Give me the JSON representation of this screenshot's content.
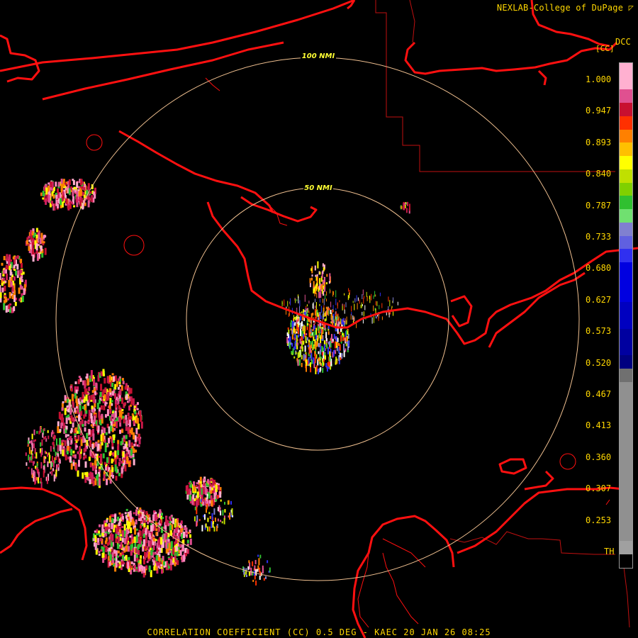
{
  "header": {
    "credit": "NEXLAB-College of DuPage",
    "product_code": "DCC",
    "product_unit": "[CC]"
  },
  "footer": {
    "title": "CORRELATION COEFFICIENT (CC) 0.5 DEG - KAEC 20 JAN 26 08:25"
  },
  "range_rings": [
    {
      "label": "100 NMI"
    },
    {
      "label": "50 NMI"
    }
  ],
  "legend": {
    "ticks": [
      "1.000",
      "0.947",
      "0.893",
      "0.840",
      "0.787",
      "0.733",
      "0.680",
      "0.627",
      "0.573",
      "0.520",
      "0.467",
      "0.413",
      "0.360",
      "0.307",
      "0.253",
      "TH"
    ],
    "colors": [
      "#ffb0d0",
      "#e05090",
      "#c81030",
      "#ff3000",
      "#ff8000",
      "#ffc000",
      "#ffff00",
      "#c0e000",
      "#80d000",
      "#30c030",
      "#70e070",
      "#8080d0",
      "#6060e0",
      "#3030f0",
      "#0000e0",
      "#0000c0",
      "#0000a0",
      "#000080",
      "#707070",
      "#909090",
      "#a0a0a0",
      "#000000"
    ],
    "colors_heights": [
      2,
      1,
      1,
      1,
      1,
      1,
      1,
      1,
      1,
      1,
      1,
      1,
      1,
      1,
      3,
      2,
      2,
      1,
      1,
      12,
      1,
      1
    ]
  },
  "map": {
    "coast_color": "#ff1010",
    "border_color": "#c01010",
    "ring_color": "#f0c090"
  }
}
